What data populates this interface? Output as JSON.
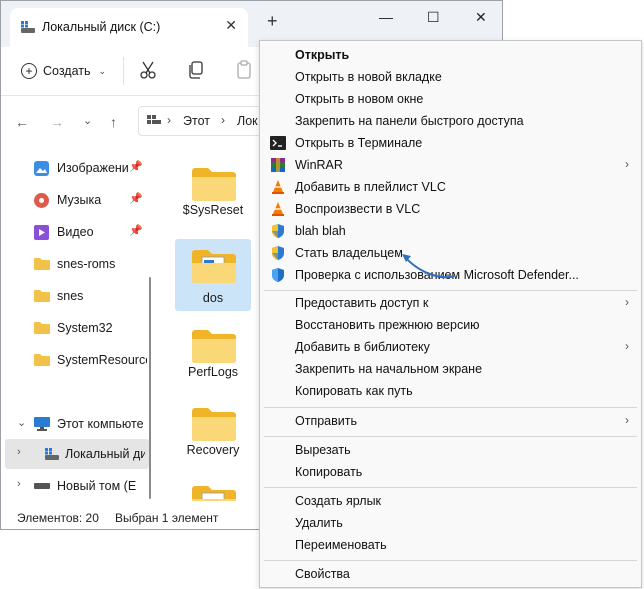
{
  "window": {
    "tab_title": "Локальный диск (C:)",
    "close_glyph": "✕",
    "new_tab_glyph": "+",
    "minimize_glyph": "—",
    "maximize_glyph": "☐",
    "win_close_glyph": "✕"
  },
  "toolbar": {
    "create_label": "Создать"
  },
  "address": {
    "crumbs": [
      "Этот",
      "Лок"
    ]
  },
  "sidebar": {
    "items": [
      {
        "label": "Изображени",
        "icon": "pictures-icon"
      },
      {
        "label": "Музыка",
        "icon": "music-icon"
      },
      {
        "label": "Видео",
        "icon": "video-icon"
      },
      {
        "label": "snes-roms",
        "icon": "folder-icon"
      },
      {
        "label": "snes",
        "icon": "folder-icon"
      },
      {
        "label": "System32",
        "icon": "folder-icon"
      },
      {
        "label": "SystemResource",
        "icon": "folder-icon"
      },
      {
        "label": "Этот компьюте",
        "icon": "computer-icon"
      },
      {
        "label": "Локальный ди",
        "icon": "drive-c-icon"
      },
      {
        "label": "Новый том (E",
        "icon": "drive-icon"
      }
    ]
  },
  "files": [
    {
      "label": "$SysReset",
      "selected": false
    },
    {
      "label": "dos",
      "selected": true
    },
    {
      "label": "PerfLogs",
      "selected": false
    },
    {
      "label": "Recovery",
      "selected": false
    },
    {
      "label": "",
      "selected": false
    }
  ],
  "status": {
    "count": "Элементов: 20",
    "selected": "Выбран 1 элемент"
  },
  "menu": {
    "items": [
      {
        "label": "Открыть",
        "bold": true
      },
      {
        "label": "Открыть в новой вкладке"
      },
      {
        "label": "Открыть в новом окне"
      },
      {
        "label": "Закрепить на панели быстрого доступа"
      },
      {
        "label": "Открыть в Терминале",
        "icon": "terminal-icon"
      },
      {
        "label": "WinRAR",
        "icon": "winrar-icon",
        "submenu": true
      },
      {
        "label": "Добавить в плейлист VLC",
        "icon": "vlc-icon"
      },
      {
        "label": "Воспроизвести в VLC",
        "icon": "vlc-icon"
      },
      {
        "label": "blah blah",
        "icon": "uac-shield-icon"
      },
      {
        "label": "Стать владельцем",
        "icon": "uac-shield-icon"
      },
      {
        "label": "Проверка с использованием Microsoft Defender...",
        "icon": "defender-icon"
      },
      {
        "label": "Предоставить доступ к",
        "submenu": true
      },
      {
        "label": "Восстановить прежнюю версию"
      },
      {
        "label": "Добавить в библиотеку",
        "submenu": true
      },
      {
        "label": "Закрепить на начальном экране"
      },
      {
        "label": "Копировать как путь"
      },
      {
        "label": "Отправить",
        "submenu": true
      },
      {
        "label": "Вырезать"
      },
      {
        "label": "Копировать"
      },
      {
        "label": "Создать ярлык"
      },
      {
        "label": "Удалить"
      },
      {
        "label": "Переименовать"
      },
      {
        "label": "Свойства"
      }
    ],
    "submenu_arrow": "›"
  },
  "colors": {
    "accent": "#2f6fbf",
    "folder": "#f3c04a",
    "selection": "#cce4f7"
  }
}
